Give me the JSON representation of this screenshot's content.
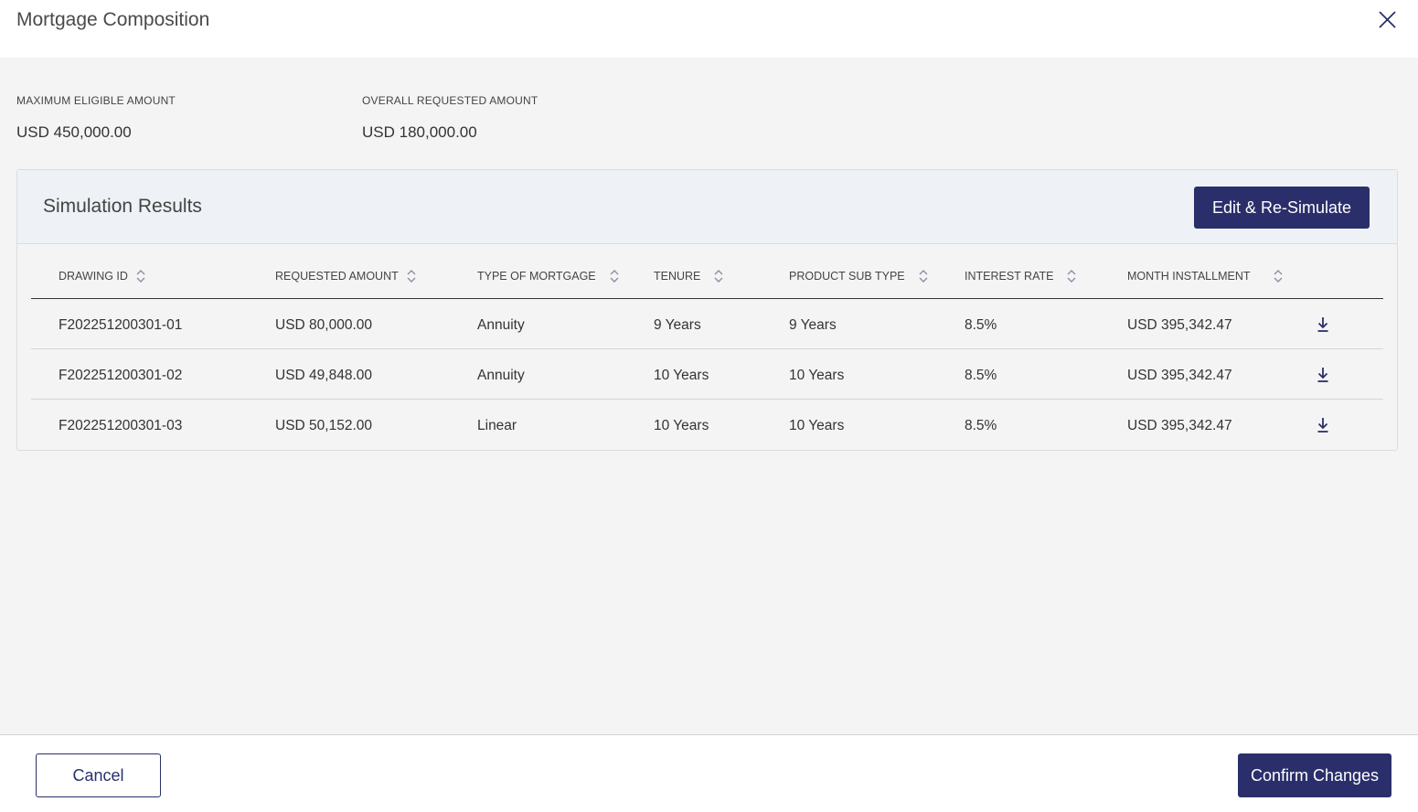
{
  "modal": {
    "title": "Mortgage Composition"
  },
  "summary": {
    "max_eligible_label": "MAXIMUM ELIGIBLE AMOUNT",
    "max_eligible_value": "USD 450,000.00",
    "overall_requested_label": "OVERALL REQUESTED AMOUNT",
    "overall_requested_value": "USD 180,000.00"
  },
  "results": {
    "title": "Simulation Results",
    "edit_button": "Edit & Re-Simulate",
    "columns": [
      "DRAWING ID",
      "REQUESTED AMOUNT",
      "TYPE OF MORTGAGE",
      "TENURE",
      "PRODUCT SUB TYPE",
      "INTEREST RATE",
      "MONTH INSTALLMENT"
    ],
    "rows": [
      {
        "drawing_id": "F202251200301-01",
        "requested_amount": "USD 80,000.00",
        "type": "Annuity",
        "tenure": "9 Years",
        "sub_type": "9 Years",
        "rate": "8.5%",
        "installment": "USD 395,342.47"
      },
      {
        "drawing_id": "F202251200301-02",
        "requested_amount": "USD 49,848.00",
        "type": "Annuity",
        "tenure": "10 Years",
        "sub_type": "10 Years",
        "rate": "8.5%",
        "installment": "USD 395,342.47"
      },
      {
        "drawing_id": "F202251200301-03",
        "requested_amount": "USD 50,152.00",
        "type": "Linear",
        "tenure": "10 Years",
        "sub_type": "10 Years",
        "rate": "8.5%",
        "installment": "USD 395,342.47"
      }
    ]
  },
  "footer": {
    "cancel_label": "Cancel",
    "confirm_label": "Confirm Changes"
  },
  "colors": {
    "primary": "#2a2f6b",
    "header_bg": "#eef2f6",
    "page_bg": "#f4f4f4"
  },
  "icons": {
    "close": "close-icon",
    "sort": "sort-icon",
    "download": "download-icon"
  }
}
